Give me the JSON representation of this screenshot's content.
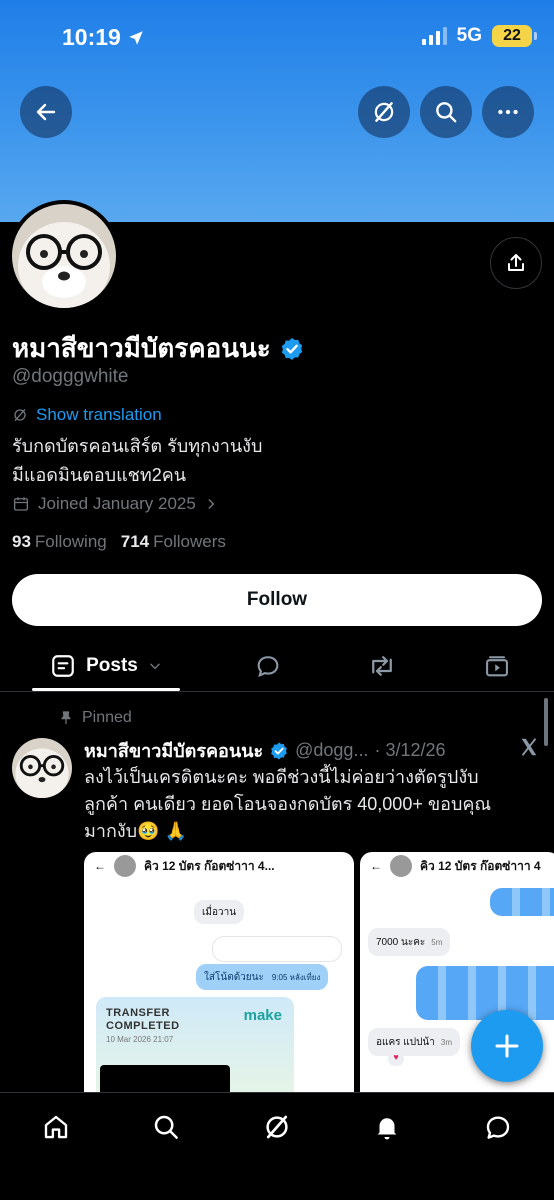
{
  "status_bar": {
    "time": "10:19",
    "network": "5G",
    "battery": "22"
  },
  "profile": {
    "display_name": "หมาสีขาวมีบัตรคอนนะ",
    "handle": "@dogggwhite",
    "show_translation": "Show translation",
    "bio_line1": "รับกดบัตรคอนเสิร์ต รับทุกงานงับ",
    "bio_line2": "มีแอดมินตอบแชท2คน",
    "joined": "Joined January 2025",
    "following_count": "93",
    "following_label": "Following",
    "followers_count": "714",
    "followers_label": "Followers",
    "follow_button": "Follow"
  },
  "tabs": {
    "posts_label": "Posts"
  },
  "post": {
    "pinned_label": "Pinned",
    "author_name": "หมาสีขาวมีบัตรคอนนะ",
    "author_handle": "@dogg...",
    "date": "· 3/12/26",
    "text_line1": "ลงไว้เป็นเครดิตนะคะ พอดีช่วงนี้ไม่ค่อยว่างตัดรูปงับ",
    "text_line2": "ลูกค้า คนเดียว ยอดโอนจองกดบัตร 40,000+ ขอบคุณ",
    "text_line3": "มากงับ🥹 🙏"
  },
  "screenshot1": {
    "chat_title": "คิว 12 บัตร ก๊อตซ่าาา 4...",
    "msg_yesterday": "เมื่อวาน",
    "msg_reply": "ใส่โน้ตด้วยนะ",
    "msg_time": "9:05 หลังเที่ยง",
    "transfer_title_1": "TRANSFER",
    "transfer_title_2": "COMPLETED",
    "transfer_date": "10 Mar 2026 21:07",
    "brand": "make"
  },
  "screenshot2": {
    "chat_title": "คิว 12 บัตร ก๊อตซ่าาา 4",
    "msg_amount": "7000 นะคะ",
    "msg_amount_time": "5m",
    "msg_name": "อแคร แปปน้า",
    "msg_name_time": "3m"
  },
  "colors": {
    "accent": "#1d9bf0",
    "banner": "#2f8ef0",
    "verified": "#1d9bf0"
  },
  "icons": [
    "back-arrow-icon",
    "translate-off-icon",
    "search-icon",
    "more-icon",
    "share-icon",
    "verified-icon",
    "calendar-icon",
    "chevron-right-icon",
    "posts-icon",
    "chevron-down-icon",
    "replies-icon",
    "retweet-icon",
    "media-icon",
    "pin-icon",
    "x-logo-icon",
    "plus-icon",
    "home-icon",
    "grok-icon",
    "bell-icon",
    "messages-icon"
  ]
}
